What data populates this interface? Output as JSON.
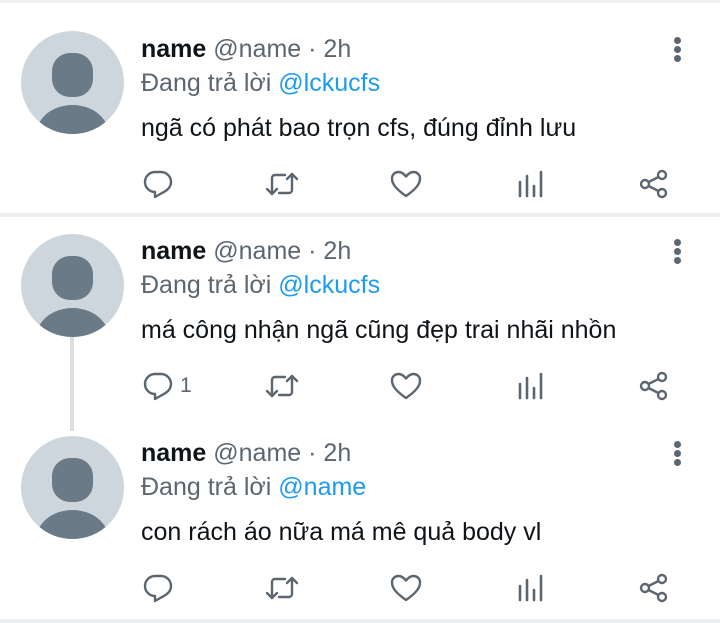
{
  "tweets": [
    {
      "name": "name",
      "handle": "@name",
      "separator": "·",
      "time": "2h",
      "replying_prefix": "Đang trả lời",
      "replying_to": "@lckucfs",
      "text": "ngã có phát bao trọn cfs, đúng đỉnh lưu",
      "reply_count": ""
    },
    {
      "name": "name",
      "handle": "@name",
      "separator": "·",
      "time": "2h",
      "replying_prefix": "Đang trả lời",
      "replying_to": "@lckucfs",
      "text": "má công nhận ngã cũng đẹp trai nhãi nhồn",
      "reply_count": "1"
    },
    {
      "name": "name",
      "handle": "@name",
      "separator": "·",
      "time": "2h",
      "replying_prefix": "Đang trả lời",
      "replying_to": "@name",
      "text": "con rách áo nữa má mê quả body vl",
      "reply_count": ""
    }
  ],
  "icons": {
    "reply": "reply-icon",
    "retweet": "retweet-icon",
    "like": "like-icon",
    "views": "views-icon",
    "share": "share-icon",
    "more": "more-vertical-icon",
    "avatar": "default-avatar-icon"
  },
  "colors": {
    "text": "#0f1419",
    "secondary": "#5b6670",
    "link": "#1d9bf0",
    "avatar_bg": "#cdd6dc",
    "avatar_fg": "#6b7a87",
    "divider": "#eceff1"
  }
}
